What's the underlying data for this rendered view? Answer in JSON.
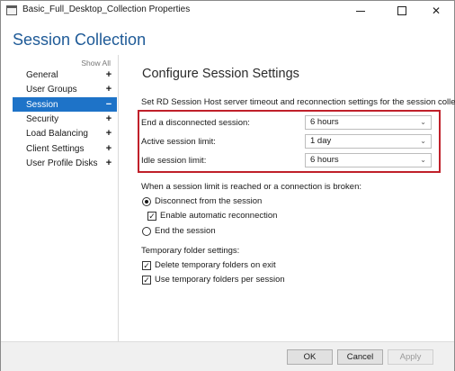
{
  "window": {
    "title": "Basic_Full_Desktop_Collection Properties",
    "minimize_label": "",
    "maximize_label": "",
    "close_label": "✕"
  },
  "header": {
    "title": "Session Collection"
  },
  "sidebar": {
    "show_all": "Show All",
    "items": [
      {
        "label": "General",
        "sign": "+"
      },
      {
        "label": "User Groups",
        "sign": "+"
      },
      {
        "label": "Session",
        "sign": "−"
      },
      {
        "label": "Security",
        "sign": "+"
      },
      {
        "label": "Load Balancing",
        "sign": "+"
      },
      {
        "label": "Client Settings",
        "sign": "+"
      },
      {
        "label": "User Profile Disks",
        "sign": "+"
      }
    ],
    "active_index": 2
  },
  "main": {
    "section_title": "Configure Session Settings",
    "description": "Set RD Session Host server timeout and reconnection settings for the session collection.",
    "settings": [
      {
        "label": "End a disconnected session:",
        "value": "6 hours"
      },
      {
        "label": "Active session limit:",
        "value": "1 day"
      },
      {
        "label": "Idle session limit:",
        "value": "6 hours"
      }
    ],
    "limit_reached_heading": "When a session limit is reached or a connection is broken:",
    "disconnect_option": "Disconnect from the session",
    "auto_reconnect_option": "Enable automatic reconnection",
    "end_session_option": "End the session",
    "temp_folder_heading": "Temporary folder settings:",
    "delete_temp_option": "Delete temporary folders on exit",
    "use_temp_option": "Use temporary folders per session"
  },
  "footer": {
    "ok_label": "OK",
    "cancel_label": "Cancel",
    "apply_label": "Apply"
  },
  "colors": {
    "accent": "#1e73c8",
    "heading": "#1e5a97",
    "highlight": "#c0202a"
  },
  "icons": {
    "chevron": "chevron-down-icon",
    "check": "checkmark-icon"
  }
}
